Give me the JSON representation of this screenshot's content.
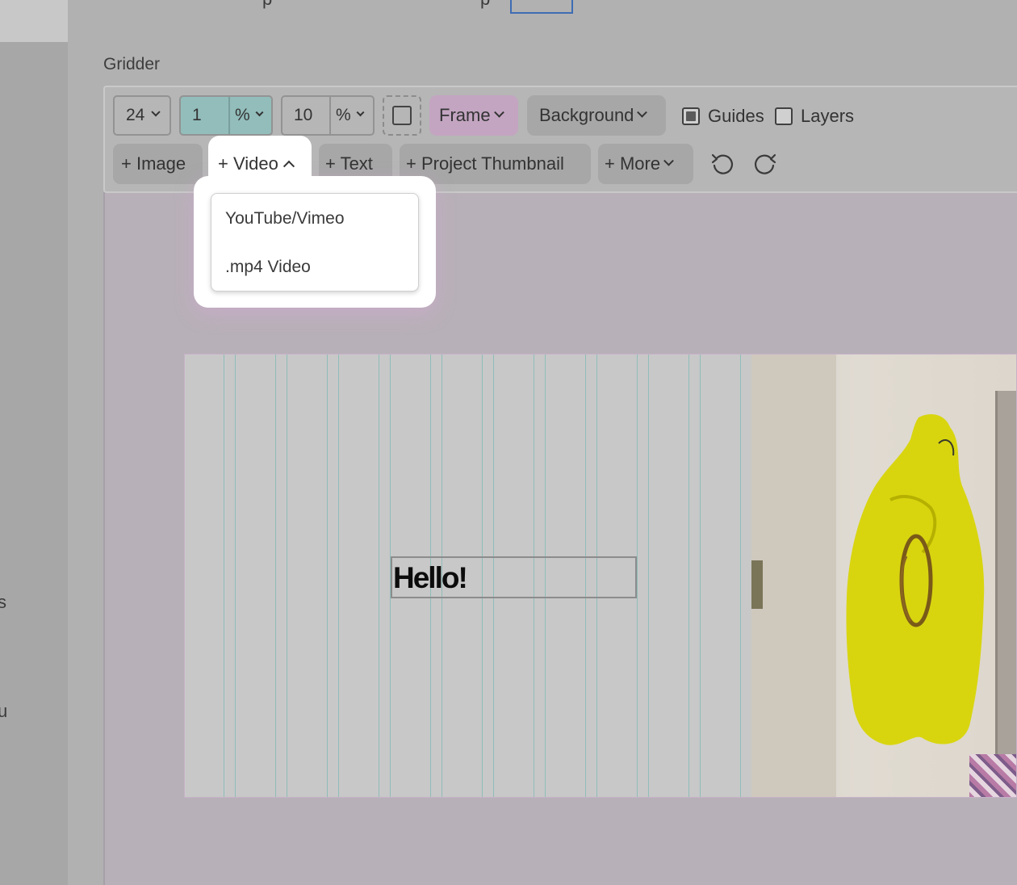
{
  "sidebar": {
    "fragments": [
      "s",
      "u"
    ]
  },
  "topbar": {
    "fragments": [
      "p",
      "p"
    ]
  },
  "gridder": {
    "title": "Gridder"
  },
  "toolbar": {
    "columns": "24",
    "gutter_value": "1",
    "gutter_unit": "%",
    "padding_value": "10",
    "padding_unit": "%",
    "frame_label": "Frame",
    "background_label": "Background",
    "guides_label": "Guides",
    "guides_checked": true,
    "layers_label": "Layers",
    "layers_checked": false,
    "add_image_label": "+ Image",
    "add_video_label": "+ Video",
    "add_text_label": "+ Text",
    "add_thumbnail_label": "+ Project Thumbnail",
    "add_more_label": "+ More"
  },
  "video_menu": {
    "items": [
      "YouTube/Vimeo",
      ".mp4 Video"
    ]
  },
  "canvas": {
    "text_content": "Hello!",
    "guide_count": 24
  },
  "colors": {
    "accent_teal": "#92bdbb",
    "frame_pink": "#c8a8c8",
    "guide_line": "#8fbdb9"
  }
}
